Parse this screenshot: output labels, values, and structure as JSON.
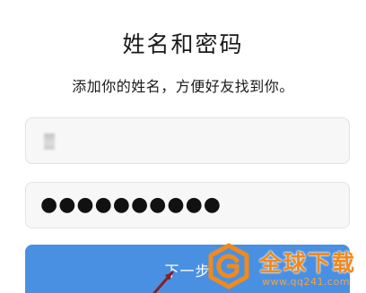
{
  "header": {
    "title": "姓名和密码",
    "subtitle": "添加你的姓名，方便好友找到你。"
  },
  "form": {
    "name_field": {
      "value": ""
    },
    "password_field": {
      "value": "●●●●●●●●●●"
    },
    "next_button": {
      "label": "下一步"
    }
  },
  "watermark": {
    "text": "全球下载",
    "url": "www.qq241.com"
  },
  "colors": {
    "button": "#4a90e2",
    "watermark": "#f08a1c",
    "field_bg": "#f7f7f8"
  }
}
